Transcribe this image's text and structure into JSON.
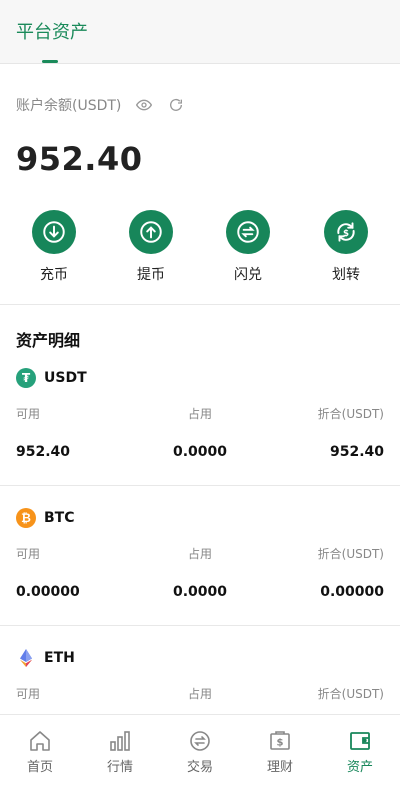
{
  "header": {
    "active_tab": "平台资产"
  },
  "balance": {
    "label": "账户余额(USDT)",
    "value": "952.40"
  },
  "actions": [
    {
      "label": "充币",
      "icon": "deposit-icon"
    },
    {
      "label": "提币",
      "icon": "withdraw-icon"
    },
    {
      "label": "闪兑",
      "icon": "swap-icon"
    },
    {
      "label": "划转",
      "icon": "transfer-icon"
    }
  ],
  "section_title": "资产明细",
  "columns": {
    "available": "可用",
    "occupied": "占用",
    "converted": "折合(USDT)"
  },
  "assets": [
    {
      "symbol": "USDT",
      "available": "952.40",
      "occupied": "0.0000",
      "converted": "952.40",
      "color": "#26a17b"
    },
    {
      "symbol": "BTC",
      "available": "0.00000",
      "occupied": "0.0000",
      "converted": "0.00000",
      "color": "#f7931a"
    },
    {
      "symbol": "ETH",
      "available": "",
      "occupied": "",
      "converted": "",
      "color": "#627eea"
    }
  ],
  "bottom_nav": [
    {
      "label": "首页",
      "icon": "home-icon"
    },
    {
      "label": "行情",
      "icon": "market-icon"
    },
    {
      "label": "交易",
      "icon": "trade-icon"
    },
    {
      "label": "理财",
      "icon": "finance-icon"
    },
    {
      "label": "资产",
      "icon": "wallet-icon",
      "active": true
    }
  ],
  "colors": {
    "accent": "#17865a"
  }
}
